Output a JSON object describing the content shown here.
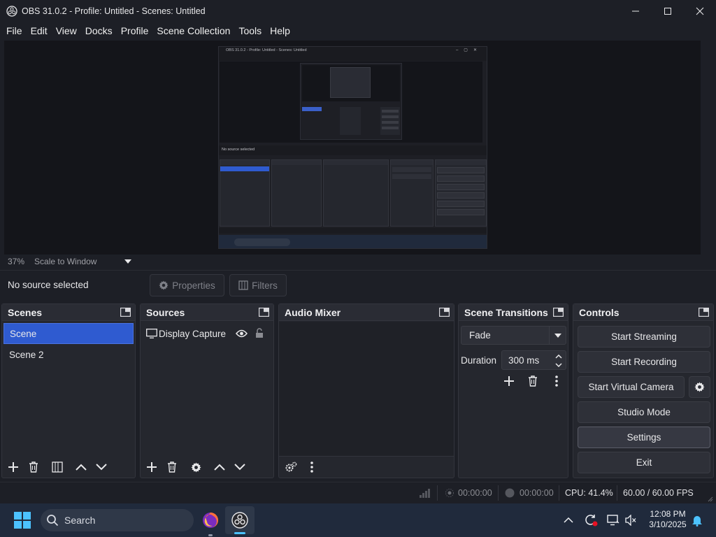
{
  "window": {
    "title": "OBS 31.0.2 - Profile: Untitled - Scenes: Untitled"
  },
  "menu": [
    "File",
    "Edit",
    "View",
    "Docks",
    "Profile",
    "Scene Collection",
    "Tools",
    "Help"
  ],
  "preview": {
    "zoom": "37%",
    "scale_mode": "Scale to Window",
    "nested_title": "OBS 31.0.2 - Profile: Untitled - Scenes: Untitled"
  },
  "source_toolbar": {
    "status": "No source selected",
    "properties_label": "Properties",
    "filters_label": "Filters"
  },
  "scenes": {
    "title": "Scenes",
    "items": [
      "Scene",
      "Scene 2"
    ],
    "selected_index": 0
  },
  "sources": {
    "title": "Sources",
    "items": [
      {
        "name": "Display Capture",
        "visible": true,
        "locked": false
      }
    ]
  },
  "audio_mixer": {
    "title": "Audio Mixer"
  },
  "transitions": {
    "title": "Scene Transitions",
    "selected": "Fade",
    "duration_label": "Duration",
    "duration_value": "300 ms"
  },
  "controls": {
    "title": "Controls",
    "start_streaming": "Start Streaming",
    "start_recording": "Start Recording",
    "start_virtual_camera": "Start Virtual Camera",
    "studio_mode": "Studio Mode",
    "settings": "Settings",
    "exit": "Exit"
  },
  "status": {
    "stream_time": "00:00:00",
    "record_time": "00:00:00",
    "cpu": "CPU: 41.4%",
    "fps": "60.00 / 60.00 FPS"
  },
  "taskbar": {
    "search_placeholder": "Search",
    "time": "12:08 PM",
    "date": "3/10/2025"
  },
  "colors": {
    "background": "#1d1f26",
    "dock": "#25272e",
    "selection": "#2f5bd0",
    "taskbar": "#202a3c"
  }
}
